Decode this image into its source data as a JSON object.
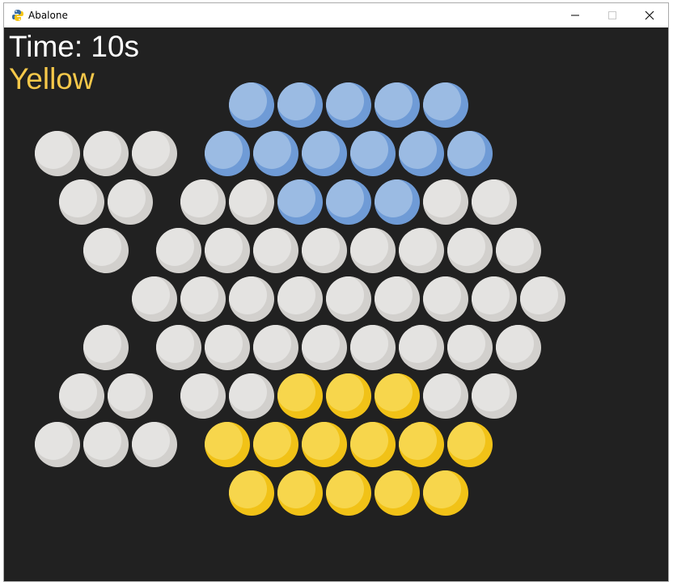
{
  "window": {
    "title": "Abalone",
    "icon": "python-icon",
    "controls": [
      "minimize-icon",
      "maximize-icon",
      "close-icon"
    ]
  },
  "hud": {
    "timer_text": "Time: 10s",
    "turn_text": "Yellow",
    "turn_color": "#f5c84a"
  },
  "colors": {
    "background": "#212121",
    "empty_cell": "#e4e3e1",
    "empty_shade": "#d2d0cd",
    "blue": "#9bbbe3",
    "blue_shade": "#6f9bd6",
    "yellow": "#f7d64c",
    "yellow_shade": "#f1c217"
  },
  "board": {
    "rows": [
      [
        "B",
        "B",
        "B",
        "B",
        "B"
      ],
      [
        "B",
        "B",
        "B",
        "B",
        "B",
        "B"
      ],
      [
        "E",
        "E",
        "B",
        "B",
        "B",
        "E",
        "E"
      ],
      [
        "E",
        "E",
        "E",
        "E",
        "E",
        "E",
        "E",
        "E"
      ],
      [
        "E",
        "E",
        "E",
        "E",
        "E",
        "E",
        "E",
        "E",
        "E"
      ],
      [
        "E",
        "E",
        "E",
        "E",
        "E",
        "E",
        "E",
        "E"
      ],
      [
        "E",
        "E",
        "Y",
        "Y",
        "Y",
        "E",
        "E"
      ],
      [
        "Y",
        "Y",
        "Y",
        "Y",
        "Y",
        "Y"
      ],
      [
        "Y",
        "Y",
        "Y",
        "Y",
        "Y"
      ]
    ]
  },
  "captured": {
    "top": [
      3,
      2,
      1
    ],
    "bottom": [
      1,
      2,
      3
    ]
  }
}
